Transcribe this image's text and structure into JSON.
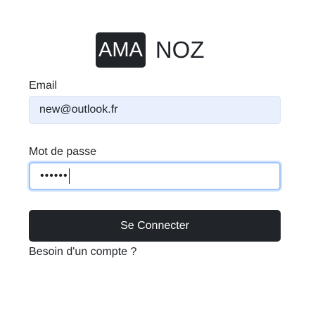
{
  "logo": {
    "badge_text": "AMA",
    "text": "NOZ"
  },
  "form": {
    "email_label": "Email",
    "email_value": "new@outlook.fr",
    "password_label": "Mot de passe",
    "password_mask": "••••••",
    "submit_label": "Se Connecter",
    "account_link": "Besoin d'un compte ?"
  },
  "colors": {
    "primary": "#212529",
    "autofill_bg": "#e8f0fe",
    "focus_ring": "#9ec5fe"
  }
}
